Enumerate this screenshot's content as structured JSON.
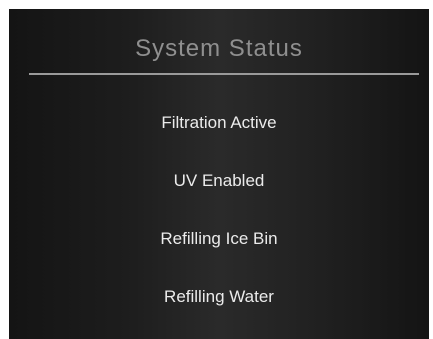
{
  "panel": {
    "title": "System Status",
    "items": [
      {
        "label": "Filtration Active"
      },
      {
        "label": "UV Enabled"
      },
      {
        "label": "Refilling Ice Bin"
      },
      {
        "label": "Refilling Water"
      }
    ]
  }
}
